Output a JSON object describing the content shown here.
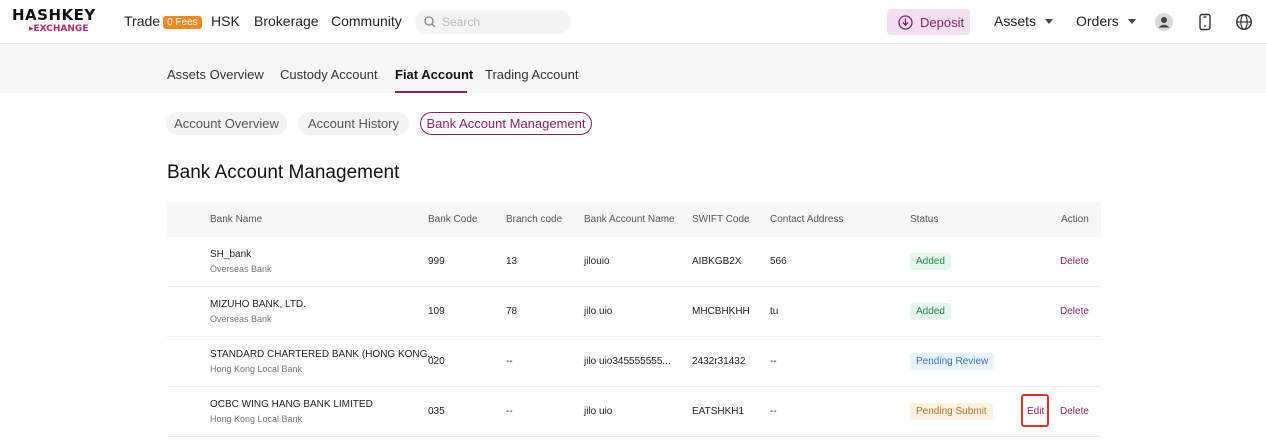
{
  "brand": {
    "line1": "HASHKEY",
    "line2": "EXCHANGE"
  },
  "nav": {
    "trade": "Trade",
    "trade_badge": "0 Fees",
    "hsk": "HSK",
    "brokerage": "Brokerage",
    "community": "Community",
    "search_placeholder": "Search",
    "deposit": "Deposit",
    "assets": "Assets",
    "orders": "Orders"
  },
  "tabs": [
    "Assets Overview",
    "Custody Account",
    "Fiat Account",
    "Trading Account"
  ],
  "subtabs": [
    "Account Overview",
    "Account History",
    "Bank Account Management"
  ],
  "page_title": "Bank Account Management",
  "table": {
    "headers": [
      "Bank Name",
      "Bank Code",
      "Branch code",
      "Bank Account Name",
      "SWIFT Code",
      "Contact Address",
      "Status",
      "Action"
    ],
    "rows": [
      {
        "bank_name": "SH_bank",
        "bank_type": "Overseas Bank",
        "bank_code": "999",
        "branch_code": "13",
        "account_name": "jilouio",
        "swift": "AIBKGB2X",
        "address": "566",
        "status": "Added",
        "edit": "",
        "delete": "Delete"
      },
      {
        "bank_name": "MIZUHO BANK, LTD.",
        "bank_type": "Overseas Bank",
        "bank_code": "109",
        "branch_code": "78",
        "account_name": "jilo uio",
        "swift": "MHCBHKHH",
        "address": "tu",
        "status": "Added",
        "edit": "",
        "delete": "Delete"
      },
      {
        "bank_name": "STANDARD CHARTERED BANK (HONG KONG...",
        "bank_type": "Hong Kong Local Bank",
        "bank_code": "020",
        "branch_code": "--",
        "account_name": "jilo uio345555555...",
        "swift": "2432r31432",
        "address": "--",
        "status": "Pending Review",
        "edit": "",
        "delete": ""
      },
      {
        "bank_name": "OCBC WING HANG BANK LIMITED",
        "bank_type": "Hong Kong Local Bank",
        "bank_code": "035",
        "branch_code": "--",
        "account_name": "jilo uio",
        "swift": "EATSHKH1",
        "address": "--",
        "status": "Pending Submit",
        "edit": "Edit",
        "delete": "Delete"
      }
    ]
  },
  "colors": {
    "accent": "#8e1f69",
    "highlight": "#e0322f"
  },
  "icons": [
    "search-icon",
    "download-icon",
    "user-icon",
    "phone-icon",
    "globe-icon"
  ]
}
